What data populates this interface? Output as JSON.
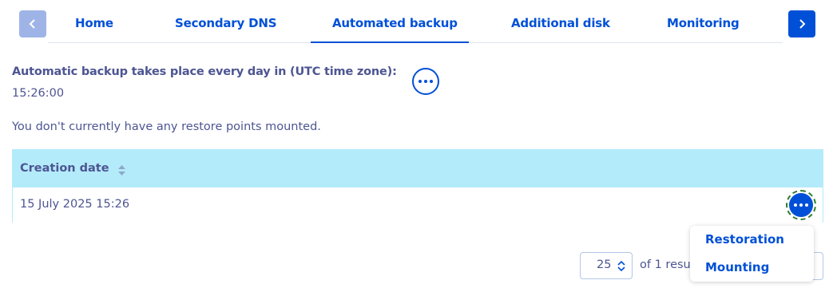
{
  "nav": {
    "prev_icon": "chevron-left-icon",
    "next_icon": "chevron-right-icon"
  },
  "tabs": [
    {
      "label": "Home"
    },
    {
      "label": "Secondary DNS"
    },
    {
      "label": "Automated backup",
      "active": true
    },
    {
      "label": "Additional disk"
    },
    {
      "label": "Monitoring"
    }
  ],
  "schedule": {
    "label": "Automatic backup takes place every day in (UTC time zone):",
    "time": "15:26:00",
    "menu_icon": "more-options-icon"
  },
  "notice": "You don't currently have any restore points mounted.",
  "table": {
    "columns": [
      {
        "label": "Creation date",
        "sortable": true
      }
    ],
    "rows": [
      {
        "date": "15 July 2025 15:26",
        "menu_icon": "more-options-icon"
      }
    ]
  },
  "pagination": {
    "page_size": "25",
    "summary": "of 1 resu"
  },
  "row_actions": [
    {
      "label": "Restoration"
    },
    {
      "label": "Mounting"
    }
  ],
  "colors": {
    "primary": "#0050d7",
    "text": "#4d5592",
    "table_header": "#b3ebfb",
    "disabled_button": "#9fb4e6",
    "focus_ring": "#2d7d2d"
  }
}
